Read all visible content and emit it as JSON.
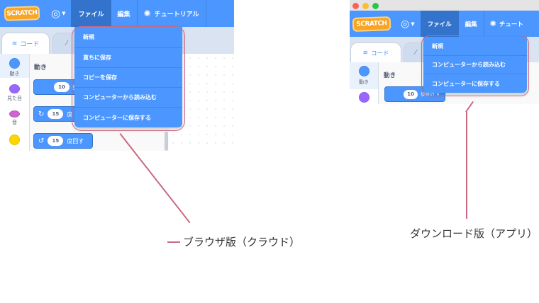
{
  "browser": {
    "logo_text": "SCRATCH",
    "menu": {
      "file": "ファイル",
      "edit": "編集",
      "tutorials": "チュートリアル"
    },
    "tabs": {
      "code": "コード"
    },
    "categories": [
      {
        "label": "動き",
        "color": "#4c97ff"
      },
      {
        "label": "見た目",
        "color": "#9966ff"
      },
      {
        "label": "音",
        "color": "#cf63cf"
      },
      {
        "label": "",
        "color": "#ffd500"
      }
    ],
    "palette_title": "動き",
    "blocks": [
      {
        "value": "10",
        "text": "歩"
      },
      {
        "value": "15",
        "text": "度"
      },
      {
        "value": "15",
        "text": "度回す"
      }
    ],
    "dropdown": [
      "新規",
      "直ちに保存",
      "コピーを保存",
      "コンピューターから読み込む",
      "コンピューターに保存する"
    ],
    "callout": "ブラウザ版（クラウド）"
  },
  "app": {
    "logo_text": "SCRATCH",
    "menu": {
      "file": "ファイル",
      "edit": "編集",
      "tutorials": "チュート"
    },
    "tabs": {
      "code": "コード"
    },
    "categories": [
      {
        "label": "動き",
        "color": "#4c97ff"
      },
      {
        "label": "",
        "color": "#9966ff"
      }
    ],
    "palette_title": "動き",
    "blocks": [
      {
        "value": "10",
        "text": "歩動かす"
      }
    ],
    "dropdown": [
      "新規",
      "コンピューターから読み込む",
      "コンピューターに保存する"
    ],
    "callout": "ダウンロード版（アプリ）"
  },
  "colors": {
    "menubar": "#4c97ff",
    "menu_active": "#3373cc",
    "highlight": "#c96a82",
    "traffic_lights": [
      "#fe5f57",
      "#febc2e",
      "#28c840"
    ]
  }
}
